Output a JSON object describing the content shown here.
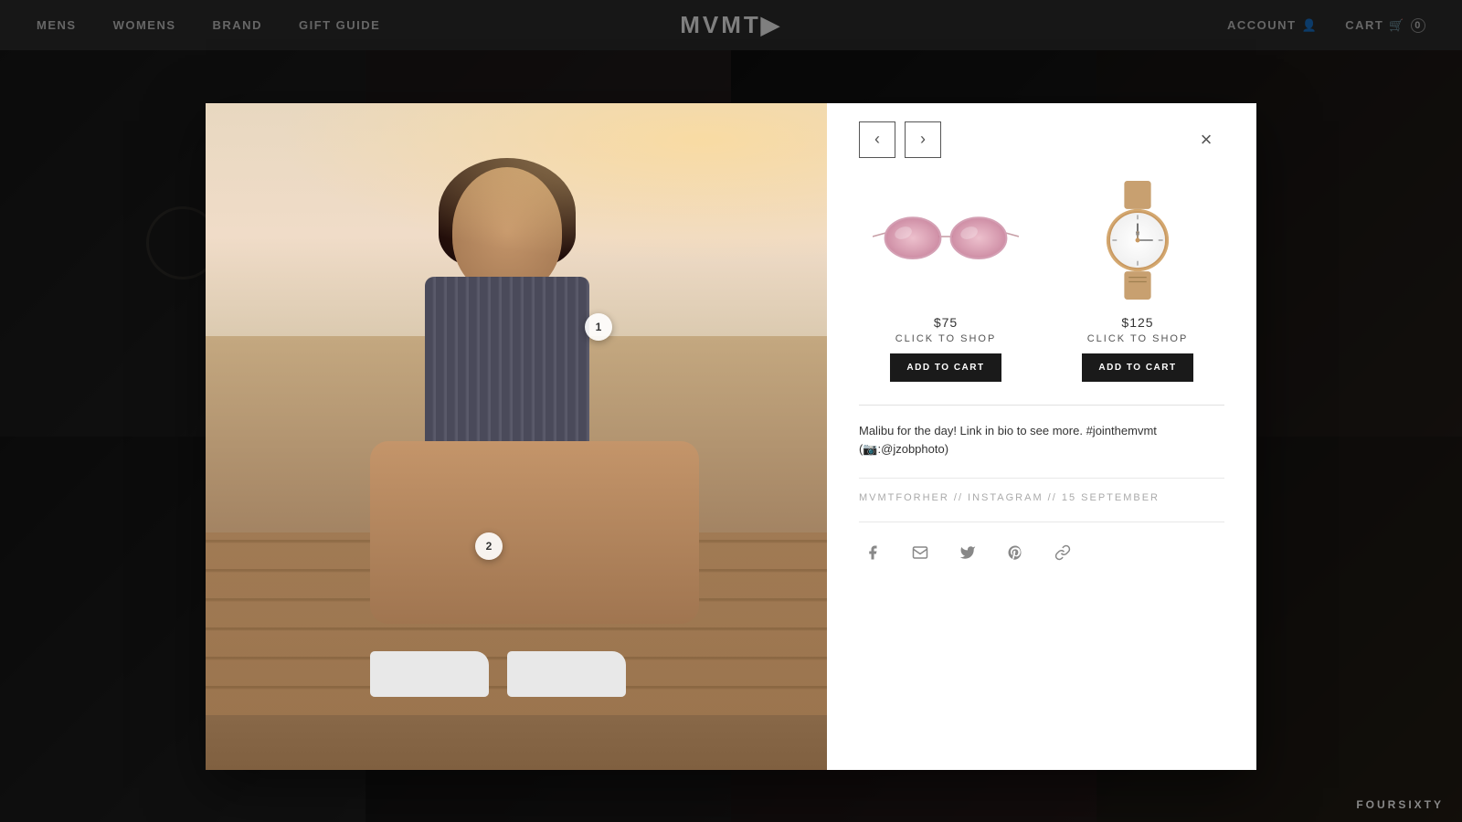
{
  "nav": {
    "links": [
      "MENS",
      "WOMENS",
      "BRAND",
      "GIFT GUIDE"
    ],
    "logo": "MVMT▶",
    "account_label": "ACCOUNT",
    "cart_label": "CART",
    "cart_count": "0"
  },
  "modal": {
    "prev_arrow": "‹",
    "next_arrow": "›",
    "close": "×",
    "products": [
      {
        "id": 1,
        "price": "$75",
        "click_label": "CLICK TO SHOP",
        "add_label": "ADD TO CART",
        "type": "sunglasses"
      },
      {
        "id": 2,
        "price": "$125",
        "click_label": "CLICK TO SHOP",
        "add_label": "ADD TO CART",
        "type": "watch"
      }
    ],
    "caption": "Malibu for the day! Link in bio to see more. #jointhemvmt",
    "photo_credit": "(📷:@jzobphoto)",
    "meta": "MVMTFORHER // INSTAGRAM // 15 SEPTEMBER",
    "social_icons": [
      "facebook",
      "email",
      "twitter",
      "pinterest",
      "link"
    ]
  },
  "foursixty": "FOURSIXTY"
}
